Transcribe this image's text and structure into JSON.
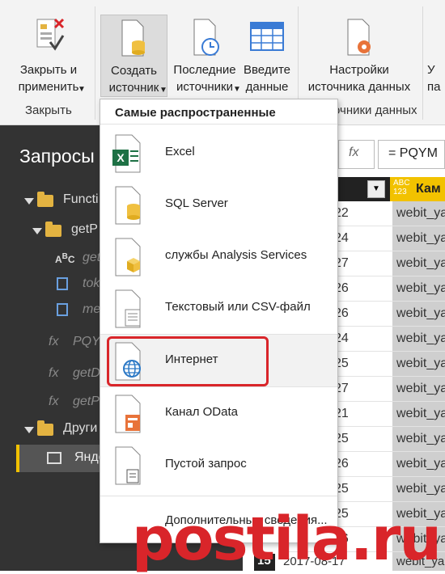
{
  "ribbon": {
    "close_apply": "Закрыть и\nприменить",
    "group_close": "Закрыть",
    "new_source": "Создать\nисточник",
    "recent_sources": "Последние\nисточники",
    "enter_data": "Введите\nданные",
    "source_settings": "Настройки\nисточника данных",
    "group_sources_partial": "очники данных",
    "partial_right_1": "У",
    "partial_right_2": "па"
  },
  "queries": {
    "title": "Запросы",
    "items": [
      {
        "label": "Functi",
        "kind": "folder"
      },
      {
        "label": "getP",
        "kind": "folder"
      },
      {
        "label": "get",
        "kind": "text"
      },
      {
        "label": "tok",
        "kind": "table"
      },
      {
        "label": "me",
        "kind": "table"
      },
      {
        "label": "PQY",
        "kind": "fx"
      },
      {
        "label": "getD",
        "kind": "fx"
      },
      {
        "label": "getP",
        "kind": "fx"
      },
      {
        "label": "Други",
        "kind": "folder"
      },
      {
        "label": "Яндс",
        "kind": "table"
      }
    ]
  },
  "formula_bar": {
    "fx": "fx",
    "text": "=  PQYM"
  },
  "grid": {
    "col_header_type": "ABC\n123",
    "col_header_partial": "Кам",
    "rows": [
      {
        "v1": "22",
        "v2": "webit_ya"
      },
      {
        "v1": "24",
        "v2": "webit_ya"
      },
      {
        "v1": "27",
        "v2": "webit_ya"
      },
      {
        "v1": "26",
        "v2": "webit_ya"
      },
      {
        "v1": "26",
        "v2": "webit_ya"
      },
      {
        "v1": "24",
        "v2": "webit_ya"
      },
      {
        "v1": "25",
        "v2": "webit_ya"
      },
      {
        "v1": "27",
        "v2": "webit_ya"
      },
      {
        "v1": "21",
        "v2": "webit_ya"
      },
      {
        "v1": "25",
        "v2": "webit_ya"
      },
      {
        "v1": "26",
        "v2": "webit_ya"
      },
      {
        "v1": "25",
        "v2": "webit_ya"
      },
      {
        "v1": "25",
        "v2": "webit_ya"
      },
      {
        "v1": "26",
        "v2": "webit_ya"
      },
      {
        "v1": "27",
        "v2": "webit_ya"
      }
    ],
    "last_row": {
      "num": "15",
      "date": "2017-08-17",
      "value": "webit_ya"
    }
  },
  "dropdown": {
    "heading": "Самые распространенные",
    "items": [
      {
        "label": "Excel",
        "icon": "excel-icon"
      },
      {
        "label": "SQL Server",
        "icon": "database-icon"
      },
      {
        "label": "службы Analysis Services",
        "icon": "cube-icon"
      },
      {
        "label": "Текстовый или CSV-файл",
        "icon": "text-file-icon"
      },
      {
        "label": "Интернет",
        "icon": "globe-icon"
      },
      {
        "label": "Канал OData",
        "icon": "odata-icon"
      },
      {
        "label": "Пустой запрос",
        "icon": "blank-query-icon"
      }
    ],
    "more": "Дополнительные сведения..."
  },
  "watermark": "postila.ru",
  "colors": {
    "highlight": "#d9252a",
    "dark_panel": "#333333",
    "accent_header": "#f2c200"
  }
}
